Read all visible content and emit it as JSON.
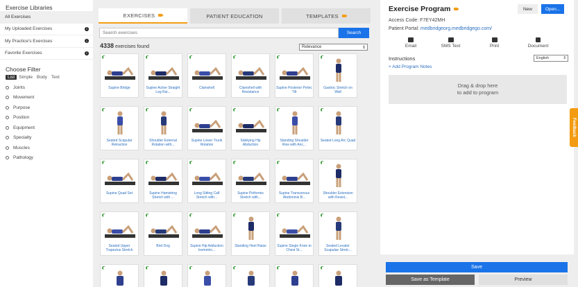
{
  "sidebar": {
    "libraries_title": "Exercise Libraries",
    "libraries": [
      {
        "label": "All Exercises",
        "info": false
      },
      {
        "label": "My Uploaded Exercises",
        "info": true
      },
      {
        "label": "My Practice's Exercises",
        "info": true
      },
      {
        "label": "Favorite Exercises",
        "info": true
      }
    ],
    "filter_title": "Choose Filter",
    "filter_tabs": [
      "List",
      "Simple",
      "Body",
      "Text"
    ],
    "filters": [
      "Joints",
      "Movement",
      "Purpose",
      "Position",
      "Equipment",
      "Specialty",
      "Muscles",
      "Pathology"
    ]
  },
  "center": {
    "tabs": [
      {
        "label": "EXERCISES",
        "camera": true
      },
      {
        "label": "PATIENT EDUCATION",
        "camera": false
      },
      {
        "label": "TEMPLATES",
        "camera": true
      }
    ],
    "search_placeholder": "Search exercises",
    "search_button": "Search",
    "found_count": "4338",
    "found_suffix": " exercises found",
    "sort_value": "Relevance",
    "exercises": [
      "Supine Bridge",
      "Supine Active Straight Leg Rai...",
      "Clamshell",
      "Clamshell with Resistance",
      "Supine Posterior Pelvic Tilt",
      "Gastroc Stretch on Wall",
      "Seated Scapular Retraction",
      "Shoulder External Rotation with...",
      "Supine Lower Trunk Rotation",
      "Sidelying Hip Abduction",
      "Standing Shoulder Row with Anc...",
      "Seated Long Arc Quad",
      "Supine Quad Set",
      "Supine Hamstring Stretch with ...",
      "Long Sitting Calf Stretch with...",
      "Supine Piriformis Stretch with...",
      "Supine Transversus Abdominis B...",
      "Shoulder Extension with Resist...",
      "Seated Upper Trapezius Stretch",
      "Bird Dog",
      "Supine Hip Adduction Isometric...",
      "Standing Heel Raise",
      "Supine Single Knee to Chest St...",
      "Seated Levator Scapulae Stretc..."
    ]
  },
  "program": {
    "title": "Exercise Program",
    "new_button": "New",
    "open_button": "Open...",
    "access_label": "Access Code: ",
    "access_code": "F7EY42MH",
    "portal_label": "Patient Portal: ",
    "portal_url": "medbridgeorg.medbridgego.com/",
    "actions": [
      {
        "label": "Email",
        "icon": "mail-icon"
      },
      {
        "label": "SMS Text",
        "icon": "chat-icon"
      },
      {
        "label": "Print",
        "icon": "printer-icon"
      },
      {
        "label": "Document",
        "icon": "document-icon"
      }
    ],
    "instructions_label": "Instructions",
    "language": "English",
    "add_notes": "+ Add Program Notes",
    "dropzone_line1": "Drag & drop here",
    "dropzone_line2": "to add to program",
    "save_button": "Save",
    "template_button": "Save as Template",
    "preview_button": "Preview"
  },
  "feedback_label": "Feedback",
  "colors": {
    "accent": "#1a73e8",
    "orange": "#f39c12",
    "link": "#2a6fbf",
    "plus": "#3c9d3c"
  }
}
